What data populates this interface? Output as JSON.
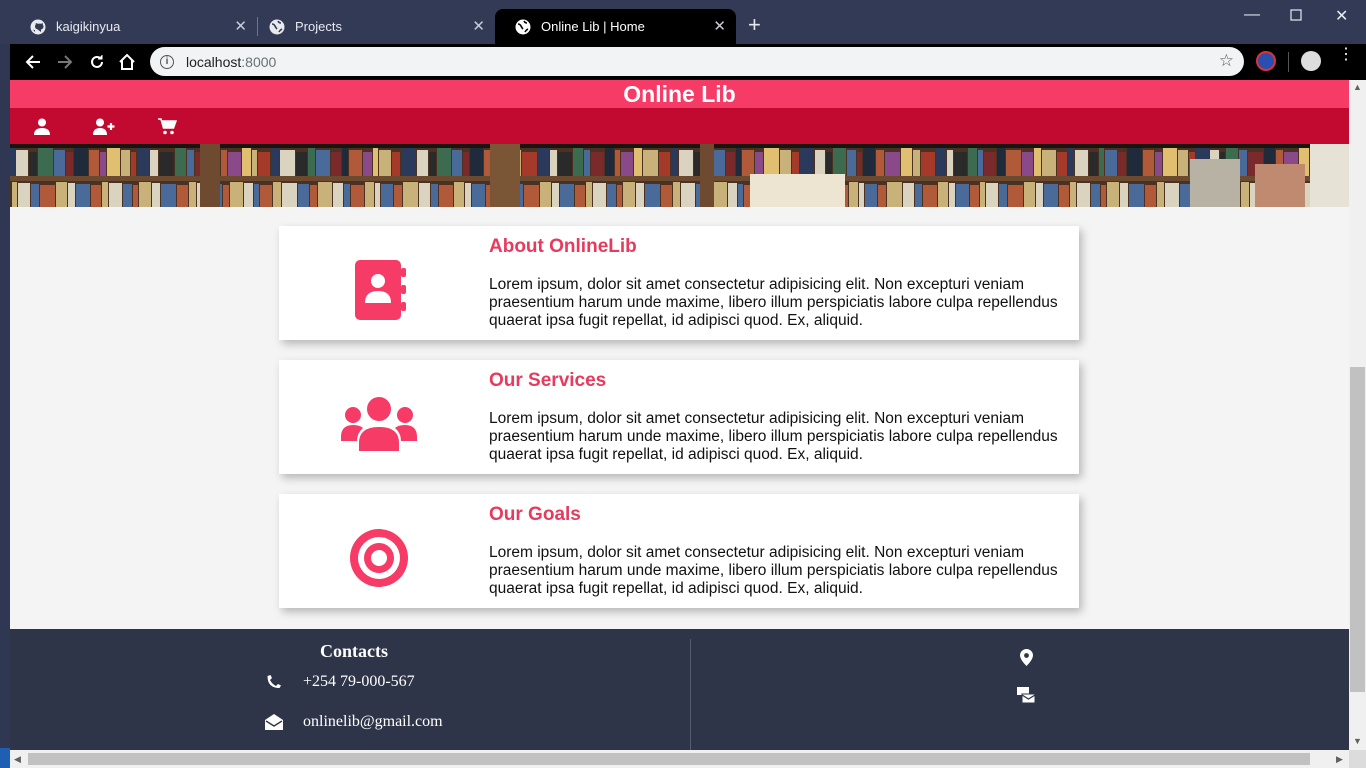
{
  "browser": {
    "tabs": [
      {
        "title": "kaigikinyua",
        "icon": "github-icon"
      },
      {
        "title": "Projects",
        "icon": "globe-icon"
      },
      {
        "title": "Online Lib | Home",
        "icon": "globe-icon",
        "active": true
      }
    ],
    "url_host": "localhost",
    "url_port": ":8000"
  },
  "site": {
    "title": "Online Lib",
    "nav": [
      {
        "icon": "user-icon"
      },
      {
        "icon": "user-plus-icon"
      },
      {
        "icon": "cart-icon"
      }
    ]
  },
  "cards": [
    {
      "title": "About OnlineLib",
      "icon": "address-book-icon",
      "text": "Lorem ipsum, dolor sit amet consectetur adipisicing elit. Non excepturi veniam praesentium harum unde maxime, libero illum perspiciatis labore culpa repellendus quaerat ipsa fugit repellat, id adipisci quod. Ex, aliquid."
    },
    {
      "title": "Our Services",
      "icon": "users-icon",
      "text": "Lorem ipsum, dolor sit amet consectetur adipisicing elit. Non excepturi veniam praesentium harum unde maxime, libero illum perspiciatis labore culpa repellendus quaerat ipsa fugit repellat, id adipisci quod. Ex, aliquid."
    },
    {
      "title": "Our Goals",
      "icon": "target-icon",
      "text": "Lorem ipsum, dolor sit amet consectetur adipisicing elit. Non excepturi veniam praesentium harum unde maxime, libero illum perspiciatis labore culpa repellendus quaerat ipsa fugit repellat, id adipisci quod. Ex, aliquid."
    }
  ],
  "footer": {
    "contacts_title": "Contacts",
    "phone": "+254 79-000-567",
    "email": "onlinelib@gmail.com"
  },
  "colors": {
    "accent": "#f53b66",
    "nav_bar": "#c2092f",
    "card_title": "#e83a5d",
    "footer_bg": "#2f3549"
  }
}
